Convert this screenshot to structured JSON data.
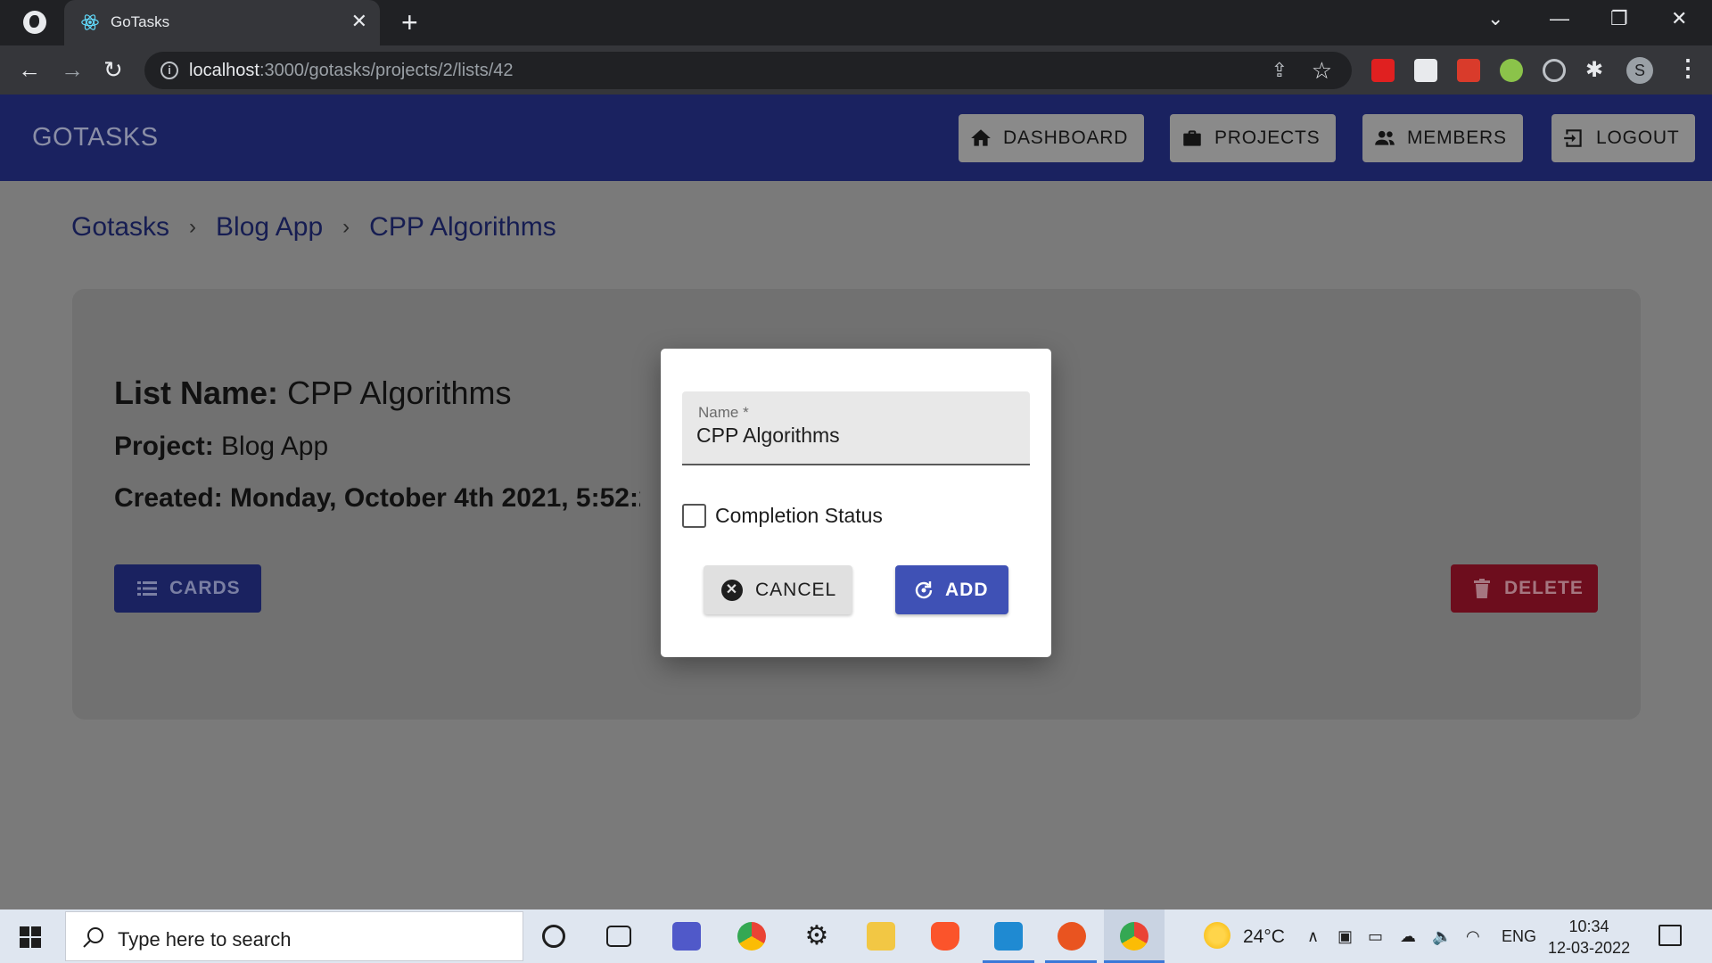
{
  "browser": {
    "tab_title": "GoTasks",
    "tab_close": "✕",
    "new_tab": "+",
    "url_host": "localhost",
    "url_path": ":3000/gotasks/projects/2/lists/42",
    "profile_initial": "S"
  },
  "app": {
    "brand": "GOTASKS",
    "nav": [
      {
        "label": "DASHBOARD",
        "icon": "home-icon"
      },
      {
        "label": "PROJECTS",
        "icon": "briefcase-icon"
      },
      {
        "label": "MEMBERS",
        "icon": "people-icon"
      },
      {
        "label": "LOGOUT",
        "icon": "logout-icon"
      }
    ]
  },
  "breadcrumb": [
    "Gotasks",
    "Blog App",
    "CPP Algorithms"
  ],
  "list_details": {
    "name_label": "List Name:",
    "name_value": "CPP Algorithms",
    "project_label": "Project:",
    "project_value": "Blog App",
    "created_label": "Created:",
    "created_value": "Monday, October 4th 2021, 5:52:24 p",
    "cards_button": "CARDS",
    "delete_button": "DELETE"
  },
  "dialog": {
    "name_label": "Name *",
    "name_value": "CPP Algorithms",
    "checkbox_label": "Completion Status",
    "checkbox_checked": false,
    "cancel_button": "CANCEL",
    "add_button": "ADD"
  },
  "taskbar": {
    "search_placeholder": "Type here to search",
    "temperature": "24°C",
    "language": "ENG",
    "time": "10:34",
    "date": "12-03-2022"
  },
  "colors": {
    "appbar": "#1a2260",
    "primary": "#3f51b5",
    "danger": "#6d0d1d",
    "overlay": "#7a7a7a"
  }
}
